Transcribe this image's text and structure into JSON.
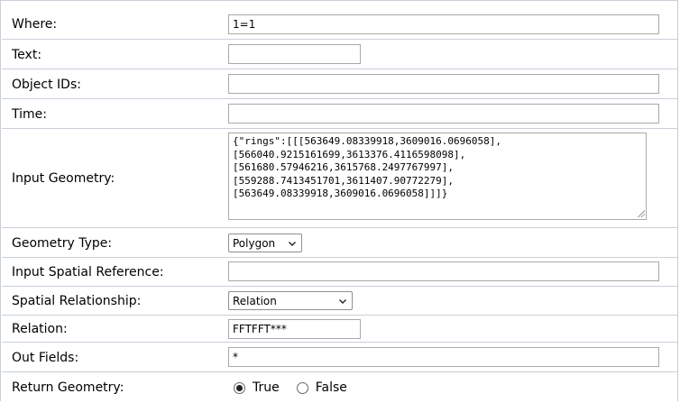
{
  "form": {
    "where": {
      "label": "Where:",
      "value": "1=1"
    },
    "text": {
      "label": "Text:",
      "value": ""
    },
    "object_ids": {
      "label": "Object IDs:",
      "value": ""
    },
    "time": {
      "label": "Time:",
      "value": ""
    },
    "input_geometry": {
      "label": "Input Geometry:",
      "value": "{\"rings\":[[[563649.08339918,3609016.0696058],\n[566040.9215161699,3613376.4116598098],\n[561680.57946216,3615768.2497767997],\n[559288.7413451701,3611407.90772279],\n[563649.08339918,3609016.0696058]]]}"
    },
    "geometry_type": {
      "label": "Geometry Type:",
      "selected": "Polygon"
    },
    "input_spatial_reference": {
      "label": "Input Spatial Reference:",
      "value": ""
    },
    "spatial_relationship": {
      "label": "Spatial Relationship:",
      "selected": "Relation"
    },
    "relation": {
      "label": "Relation:",
      "value": "FFTFFT***"
    },
    "out_fields": {
      "label": "Out Fields:",
      "value": "*"
    },
    "return_geometry": {
      "label": "Return Geometry:",
      "options": [
        "True",
        "False"
      ],
      "selected": "True"
    }
  },
  "icons": {
    "dropdown": "chevron-down-icon",
    "resize": "resize-grip-icon"
  }
}
